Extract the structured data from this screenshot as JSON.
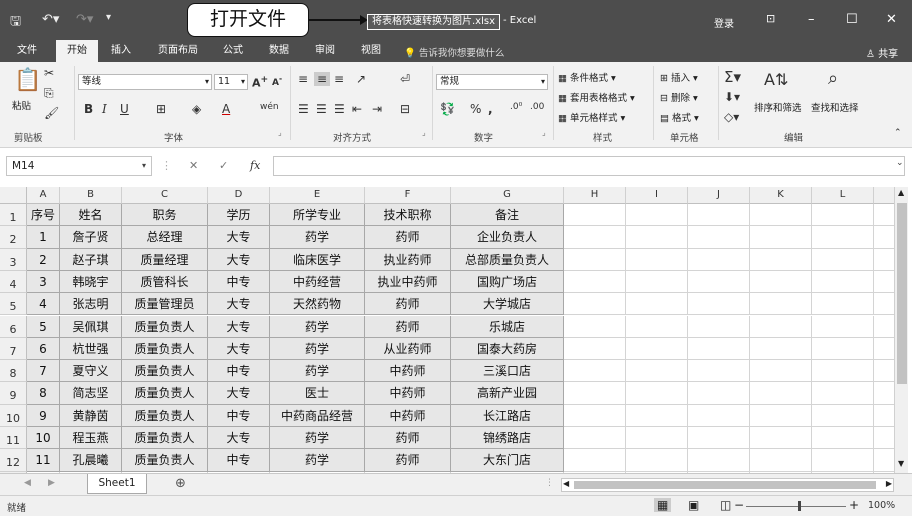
{
  "titlebar": {
    "filename": "将表格快速转换为图片.xlsx",
    "app_suffix": "- Excel",
    "login": "登录",
    "callout": "打开文件"
  },
  "tabs": [
    "文件",
    "开始",
    "插入",
    "页面布局",
    "公式",
    "数据",
    "审阅",
    "视图"
  ],
  "tell_me": "告诉我你想要做什么",
  "share": "共享",
  "ribbon": {
    "paste": "粘贴",
    "font_name": "等线",
    "font_size": "11",
    "number_format": "常规",
    "conditional_format": "条件格式",
    "table_format": "套用表格格式",
    "cell_style": "单元格样式",
    "insert": "插入",
    "delete": "删除",
    "format": "格式",
    "sort_filter": "排序和筛选",
    "find_select": "查找和选择",
    "groups": [
      "剪贴板",
      "字体",
      "对齐方式",
      "数字",
      "样式",
      "单元格",
      "编辑"
    ]
  },
  "formula_bar": {
    "name_box": "M14",
    "value": ""
  },
  "sheet": {
    "columns": [
      "A",
      "B",
      "C",
      "D",
      "E",
      "F",
      "G",
      "H",
      "I",
      "J",
      "K",
      "L"
    ],
    "rows": [
      [
        "序号",
        "姓名",
        "职务",
        "学历",
        "所学专业",
        "技术职称",
        "备注"
      ],
      [
        "1",
        "詹子贤",
        "总经理",
        "大专",
        "药学",
        "药师",
        "企业负责人"
      ],
      [
        "2",
        "赵子琪",
        "质量经理",
        "大专",
        "临床医学",
        "执业药师",
        "总部质量负责人"
      ],
      [
        "3",
        "韩晓宇",
        "质管科长",
        "中专",
        "中药经营",
        "执业中药师",
        "国购广场店"
      ],
      [
        "4",
        "张志明",
        "质量管理员",
        "大专",
        "天然药物",
        "药师",
        "大学城店"
      ],
      [
        "5",
        "吴佩琪",
        "质量负责人",
        "大专",
        "药学",
        "药师",
        "乐城店"
      ],
      [
        "6",
        "杭世强",
        "质量负责人",
        "大专",
        "药学",
        "从业药师",
        "国泰大药房"
      ],
      [
        "7",
        "夏守义",
        "质量负责人",
        "中专",
        "药学",
        "中药师",
        "三溪口店"
      ],
      [
        "8",
        "简志坚",
        "质量负责人",
        "大专",
        "医士",
        "中药师",
        "高新产业园"
      ],
      [
        "9",
        "黄静茵",
        "质量负责人",
        "中专",
        "中药商品经营",
        "中药师",
        "长江路店"
      ],
      [
        "10",
        "程玉燕",
        "质量负责人",
        "大专",
        "药学",
        "药师",
        "锦绣路店"
      ],
      [
        "11",
        "孔晨曦",
        "质量负责人",
        "中专",
        "药学",
        "药师",
        "大东门店"
      ]
    ]
  },
  "sheet_tab": "Sheet1",
  "status": {
    "ready": "就绪",
    "zoom": "100%"
  }
}
